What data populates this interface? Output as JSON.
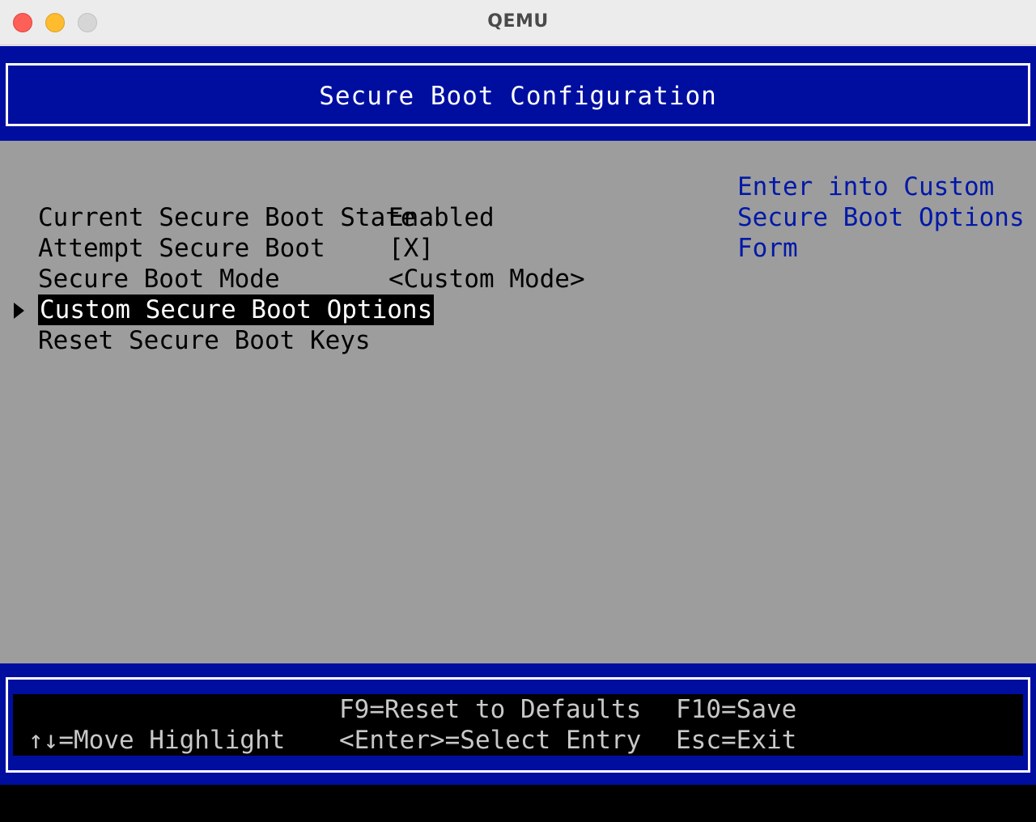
{
  "window": {
    "title": "QEMU"
  },
  "header": {
    "title": "Secure Boot Configuration"
  },
  "menu": {
    "items": [
      {
        "label": "Current Secure Boot State",
        "value": "Enabled"
      },
      {
        "label": "Attempt Secure Boot",
        "value": "[X]"
      },
      {
        "label": "Secure Boot Mode",
        "value": "<Custom Mode>"
      },
      {
        "label": "Custom Secure Boot Options",
        "value": "",
        "selected": true
      },
      {
        "label": "Reset Secure Boot Keys",
        "value": ""
      }
    ]
  },
  "help": {
    "lines": [
      "Enter into Custom",
      "Secure Boot Options",
      "Form"
    ]
  },
  "footer": {
    "move": "↑↓=Move Highlight",
    "reset": "F9=Reset to Defaults",
    "select": "<Enter>=Select Entry",
    "save": "F10=Save",
    "exit": "Esc=Exit"
  },
  "colors": {
    "header_bg": "#000ea0",
    "body_bg": "#9d9d9d",
    "help_text": "#0018a8"
  }
}
